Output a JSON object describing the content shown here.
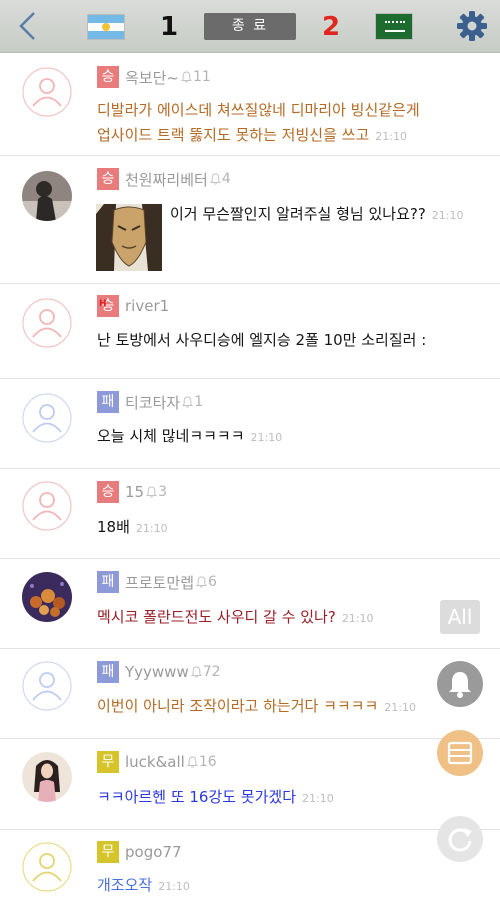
{
  "header": {
    "home_score": "1",
    "away_score": "2",
    "end_label": "종 료"
  },
  "comments": [
    {
      "badge": "승",
      "nick": "옥보단~",
      "likes": "11",
      "text_line1": "디발라가  에이스데 쳐쓰질않네  디마리아  빙신같은게",
      "text_line2": "업사이드 트랙 뚫지도  못하는 저빙신을 쓰고",
      "time": "21:10"
    },
    {
      "badge": "승",
      "nick": "천원짜리베터",
      "likes": "4",
      "text": "이거 무슨짤인지 알려주실 형님 있나요??",
      "time": "21:10"
    },
    {
      "badge": "승",
      "badge_mark": "H",
      "nick": "river1",
      "text": "난 토방에서 사우디승에  엘지승 2폴  10만  소리질러   :"
    },
    {
      "badge": "패",
      "nick": "티코타자",
      "likes": "1",
      "text": "오늘 시체 많네ㅋㅋㅋㅋ",
      "time": "21:10"
    },
    {
      "badge": "승",
      "nick": "15",
      "likes": "3",
      "text": "18배",
      "time": "21:10"
    },
    {
      "badge": "패",
      "nick": "프로토만렙",
      "likes": "6",
      "text": "멕시코 폴란드전도 사우디 갈 수 있나?",
      "time": "21:10"
    },
    {
      "badge": "패",
      "nick": "Yyywww",
      "likes": "72",
      "text": "이번이 아니라 조작이라고 하는거다 ㅋㅋㅋㅋ",
      "time": "21:10"
    },
    {
      "badge": "무",
      "nick": "luck&all",
      "likes": "16",
      "text": "ㅋㅋ아르헨 또 16강도 못가겠다",
      "time": "21:10"
    },
    {
      "badge": "무",
      "nick": "pogo77",
      "text": "개조오작",
      "time": "21:10"
    }
  ],
  "fab": {
    "all_label": "All"
  },
  "colors": {
    "win": "#e87c7c",
    "lose": "#8e9ad8",
    "draw": "#d6c42b",
    "brown": "#b56a24",
    "dark_red": "#9a1f28",
    "blue": "#2a38e0"
  }
}
